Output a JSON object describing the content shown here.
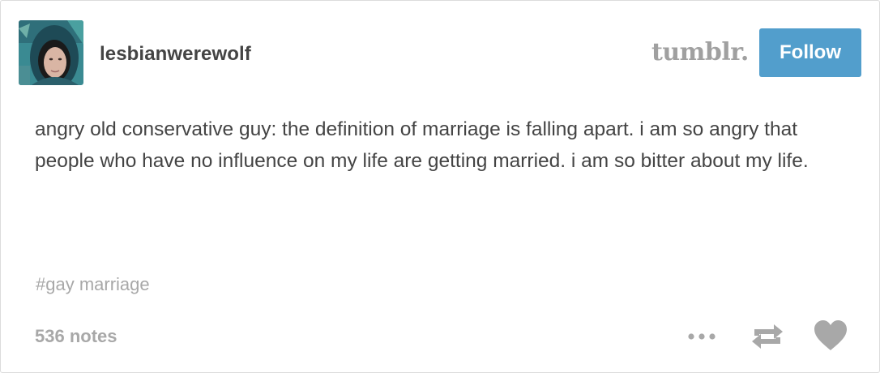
{
  "post": {
    "username": "lesbianwerewolf",
    "brand": "tumblr.",
    "follow_label": "Follow",
    "body": "angry old conservative guy: the definition of marriage is falling apart. i am so angry that people who have no influence on my life are getting married. i am so bitter about my life.",
    "tag": "#gay marriage",
    "notes": "536 notes"
  },
  "icons": {
    "more": "more-options-icon",
    "reblog": "reblog-icon",
    "like": "heart-icon"
  },
  "colors": {
    "accent": "#529ecc",
    "text": "#444444",
    "muted": "#a8a8a8",
    "brand": "#a0a0a0"
  }
}
